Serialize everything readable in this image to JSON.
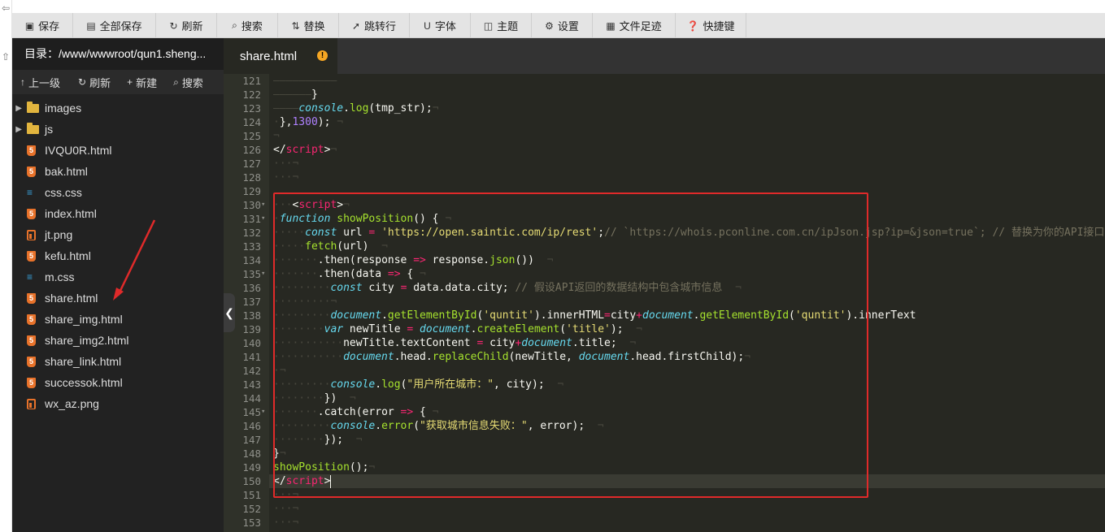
{
  "toolbar": {
    "save": "保存",
    "save_all": "全部保存",
    "refresh": "刷新",
    "search": "搜索",
    "replace": "替换",
    "goto_line": "跳转行",
    "font": "字体",
    "theme": "主题",
    "settings": "设置",
    "file_history": "文件足迹",
    "shortcuts": "快捷键"
  },
  "sidebar": {
    "directory_label": "目录：/www/wwwroot/qun1.sheng...",
    "nav": {
      "up": "上一级",
      "refresh": "刷新",
      "new": "新建",
      "search": "搜索"
    },
    "files": [
      {
        "name": "images",
        "type": "folder"
      },
      {
        "name": "js",
        "type": "folder"
      },
      {
        "name": "IVQU0R.html",
        "type": "html"
      },
      {
        "name": "bak.html",
        "type": "html"
      },
      {
        "name": "css.css",
        "type": "css"
      },
      {
        "name": "index.html",
        "type": "html"
      },
      {
        "name": "jt.png",
        "type": "image"
      },
      {
        "name": "kefu.html",
        "type": "html"
      },
      {
        "name": "m.css",
        "type": "css"
      },
      {
        "name": "share.html",
        "type": "html"
      },
      {
        "name": "share_img.html",
        "type": "html"
      },
      {
        "name": "share_img2.html",
        "type": "html"
      },
      {
        "name": "share_link.html",
        "type": "html"
      },
      {
        "name": "successok.html",
        "type": "html"
      },
      {
        "name": "wx_az.png",
        "type": "image"
      }
    ]
  },
  "editor": {
    "tab_title": "share.html",
    "tab_badge": "!",
    "current_line": 150,
    "lines": [
      {
        "n": 121,
        "fold": "",
        "code": [
          [
            "ws",
            "——————————"
          ]
        ]
      },
      {
        "n": 122,
        "fold": "",
        "code": [
          [
            "ws",
            "——————"
          ],
          [
            "",
            "}"
          ]
        ]
      },
      {
        "n": 123,
        "fold": "",
        "code": [
          [
            "ws",
            "————"
          ],
          [
            "k",
            "console"
          ],
          [
            "",
            "."
          ],
          [
            "f",
            "log"
          ],
          [
            "",
            "(tmp_str);"
          ],
          [
            "ws",
            "¬"
          ]
        ]
      },
      {
        "n": 124,
        "fold": "",
        "code": [
          [
            "ws",
            "·"
          ],
          [
            "",
            "},"
          ],
          [
            "n",
            "1300"
          ],
          [
            "",
            "); "
          ],
          [
            "ws",
            "¬"
          ]
        ]
      },
      {
        "n": 125,
        "fold": "",
        "code": [
          [
            "ws",
            "¬"
          ]
        ]
      },
      {
        "n": 126,
        "fold": "",
        "code": [
          [
            "",
            "</"
          ],
          [
            "t",
            "script"
          ],
          [
            "",
            ">"
          ],
          [
            "ws",
            "¬"
          ]
        ]
      },
      {
        "n": 127,
        "fold": "",
        "code": [
          [
            "ws",
            "···¬"
          ]
        ]
      },
      {
        "n": 128,
        "fold": "",
        "code": [
          [
            "ws",
            "···¬"
          ]
        ]
      },
      {
        "n": 129,
        "fold": "",
        "code": [
          [
            "ws",
            ""
          ]
        ]
      },
      {
        "n": 130,
        "fold": "▾",
        "code": [
          [
            "ws",
            "···"
          ],
          [
            "",
            "<"
          ],
          [
            "t",
            "script"
          ],
          [
            "",
            ">"
          ],
          [
            "ws",
            "¬"
          ]
        ]
      },
      {
        "n": 131,
        "fold": "▾",
        "code": [
          [
            "ws",
            "·"
          ],
          [
            "k",
            "function"
          ],
          [
            "",
            " "
          ],
          [
            "f",
            "showPosition"
          ],
          [
            "",
            "() {"
          ],
          [
            "ws",
            " ¬"
          ]
        ]
      },
      {
        "n": 132,
        "fold": "",
        "code": [
          [
            "ws",
            "·····"
          ],
          [
            "k",
            "const"
          ],
          [
            "",
            " url "
          ],
          [
            "t",
            "="
          ],
          [
            "",
            " "
          ],
          [
            "s",
            "'https://open.saintic.com/ip/rest'"
          ],
          [
            "",
            ";"
          ],
          [
            "c",
            "// `https://whois.pconline.com.cn/ipJson.jsp?ip=&json=true`; // 替换为你的API接口"
          ]
        ]
      },
      {
        "n": 133,
        "fold": "",
        "code": [
          [
            "ws",
            "·····"
          ],
          [
            "f",
            "fetch"
          ],
          [
            "",
            "(url)"
          ],
          [
            "ws",
            "  ¬"
          ]
        ]
      },
      {
        "n": 134,
        "fold": "",
        "code": [
          [
            "ws",
            "·······"
          ],
          [
            "",
            ".then(response "
          ],
          [
            "t",
            "=>"
          ],
          [
            "",
            " response."
          ],
          [
            "f",
            "json"
          ],
          [
            "",
            "())"
          ],
          [
            "ws",
            "  ¬"
          ]
        ]
      },
      {
        "n": 135,
        "fold": "▾",
        "code": [
          [
            "ws",
            "·······"
          ],
          [
            "",
            ".then(data "
          ],
          [
            "t",
            "=>"
          ],
          [
            "",
            " {"
          ],
          [
            "ws",
            " ¬"
          ]
        ]
      },
      {
        "n": 136,
        "fold": "",
        "code": [
          [
            "ws",
            "·········"
          ],
          [
            "k",
            "const"
          ],
          [
            "",
            " city "
          ],
          [
            "t",
            "="
          ],
          [
            "",
            " data.data.city; "
          ],
          [
            "c",
            "// 假设API返回的数据结构中包含城市信息"
          ],
          [
            "ws",
            "  ¬"
          ]
        ]
      },
      {
        "n": 137,
        "fold": "",
        "code": [
          [
            "ws",
            "·········¬"
          ]
        ]
      },
      {
        "n": 138,
        "fold": "",
        "code": [
          [
            "ws",
            "·········"
          ],
          [
            "k",
            "document"
          ],
          [
            "",
            "."
          ],
          [
            "f",
            "getElementById"
          ],
          [
            "",
            "("
          ],
          [
            "s",
            "'quntit'"
          ],
          [
            "",
            ").innerHTML"
          ],
          [
            "t",
            "="
          ],
          [
            "",
            "city"
          ],
          [
            "t",
            "+"
          ],
          [
            "k",
            "document"
          ],
          [
            "",
            "."
          ],
          [
            "f",
            "getElementById"
          ],
          [
            "",
            "("
          ],
          [
            "s",
            "'quntit'"
          ],
          [
            "",
            ").innerText"
          ]
        ]
      },
      {
        "n": 139,
        "fold": "",
        "code": [
          [
            "ws",
            "········"
          ],
          [
            "k",
            "var"
          ],
          [
            "",
            " newTitle "
          ],
          [
            "t",
            "="
          ],
          [
            "",
            " "
          ],
          [
            "k",
            "document"
          ],
          [
            "",
            "."
          ],
          [
            "f",
            "createElement"
          ],
          [
            "",
            "("
          ],
          [
            "s",
            "'title'"
          ],
          [
            "",
            ");"
          ],
          [
            "ws",
            "  ¬"
          ]
        ]
      },
      {
        "n": 140,
        "fold": "",
        "code": [
          [
            "ws",
            "···········"
          ],
          [
            "",
            "newTitle.textContent "
          ],
          [
            "t",
            "="
          ],
          [
            "",
            " city"
          ],
          [
            "t",
            "+"
          ],
          [
            "k",
            "document"
          ],
          [
            "",
            ".title;"
          ],
          [
            "ws",
            "  ¬"
          ]
        ]
      },
      {
        "n": 141,
        "fold": "",
        "code": [
          [
            "ws",
            "···········"
          ],
          [
            "k",
            "document"
          ],
          [
            "",
            ".head."
          ],
          [
            "f",
            "replaceChild"
          ],
          [
            "",
            "(newTitle, "
          ],
          [
            "k",
            "document"
          ],
          [
            "",
            ".head.firstChild);"
          ],
          [
            "ws",
            "¬"
          ]
        ]
      },
      {
        "n": 142,
        "fold": "",
        "code": [
          [
            "ws",
            "·¬"
          ]
        ]
      },
      {
        "n": 143,
        "fold": "",
        "code": [
          [
            "ws",
            "·········"
          ],
          [
            "k",
            "console"
          ],
          [
            "",
            "."
          ],
          [
            "f",
            "log"
          ],
          [
            "",
            "("
          ],
          [
            "s",
            "\"用户所在城市：\""
          ],
          [
            "",
            ", city);"
          ],
          [
            "ws",
            "  ¬"
          ]
        ]
      },
      {
        "n": 144,
        "fold": "",
        "code": [
          [
            "ws",
            "········"
          ],
          [
            "",
            "})"
          ],
          [
            "ws",
            "  ¬"
          ]
        ]
      },
      {
        "n": 145,
        "fold": "▾",
        "code": [
          [
            "ws",
            "·······"
          ],
          [
            "",
            ".catch(error "
          ],
          [
            "t",
            "=>"
          ],
          [
            "",
            " {"
          ],
          [
            "ws",
            " ¬"
          ]
        ]
      },
      {
        "n": 146,
        "fold": "",
        "code": [
          [
            "ws",
            "·········"
          ],
          [
            "k",
            "console"
          ],
          [
            "",
            "."
          ],
          [
            "f",
            "error"
          ],
          [
            "",
            "("
          ],
          [
            "s",
            "\"获取城市信息失败：\""
          ],
          [
            "",
            ", error);"
          ],
          [
            "ws",
            "  ¬"
          ]
        ]
      },
      {
        "n": 147,
        "fold": "",
        "code": [
          [
            "ws",
            "········"
          ],
          [
            "",
            "});"
          ],
          [
            "ws",
            "  ¬"
          ]
        ]
      },
      {
        "n": 148,
        "fold": "",
        "code": [
          [
            "",
            "}"
          ],
          [
            "ws",
            "¬"
          ]
        ]
      },
      {
        "n": 149,
        "fold": "",
        "code": [
          [
            "f",
            "showPosition"
          ],
          [
            "",
            "();"
          ],
          [
            "ws",
            "¬"
          ]
        ]
      },
      {
        "n": 150,
        "fold": "",
        "code": [
          [
            "",
            "</"
          ],
          [
            "t",
            "script"
          ],
          [
            "",
            ">"
          ]
        ]
      },
      {
        "n": 151,
        "fold": "",
        "code": [
          [
            "ws",
            "···¬"
          ]
        ]
      },
      {
        "n": 152,
        "fold": "",
        "code": [
          [
            "ws",
            "···¬"
          ]
        ]
      },
      {
        "n": 153,
        "fold": "",
        "code": [
          [
            "ws",
            "···¬"
          ]
        ]
      }
    ]
  }
}
